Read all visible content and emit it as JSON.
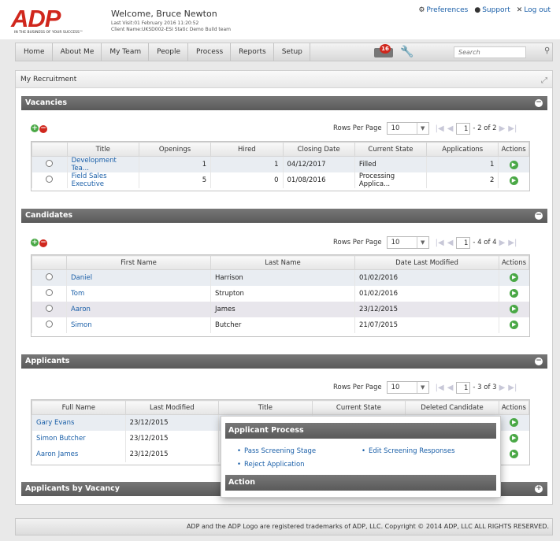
{
  "header": {
    "logo_text": "ADP",
    "logo_tagline": "IN THE BUSINESS OF YOUR SUCCESS™",
    "welcome": "Welcome, Bruce Newton",
    "last_visit": "Last Visit:01 February 2016 11:20:52",
    "client_name": "Client Name:UKSD002-ESI Static Demo Build team",
    "links": {
      "preferences": "Preferences",
      "support": "Support",
      "logout": "Log out"
    }
  },
  "nav": {
    "items": [
      "Home",
      "About Me",
      "My Team",
      "People",
      "Process",
      "Reports",
      "Setup"
    ],
    "mail_count": "16",
    "search_placeholder": "Search"
  },
  "page": {
    "title": "My Recruitment"
  },
  "vacancies": {
    "title": "Vacancies",
    "rows_per_page_label": "Rows Per Page",
    "rows_per_page": "10",
    "page_input": "1",
    "range": "- 2  of  2",
    "columns": [
      "Title",
      "Openings",
      "Hired",
      "Closing Date",
      "Current State",
      "Applications",
      "Actions"
    ],
    "rows": [
      [
        "Development Tea...",
        "1",
        "1",
        "04/12/2017",
        "Filled",
        "1"
      ],
      [
        "Field Sales Executive",
        "5",
        "0",
        "01/08/2016",
        "Processing Applica...",
        "2"
      ]
    ]
  },
  "candidates": {
    "title": "Candidates",
    "rows_per_page_label": "Rows Per Page",
    "rows_per_page": "10",
    "page_input": "1",
    "range": "- 4  of  4",
    "columns": [
      "First Name",
      "Last Name",
      "Date Last Modified",
      "Actions"
    ],
    "rows": [
      [
        "Daniel",
        "Harrison",
        "01/02/2016"
      ],
      [
        "Tom",
        "Strupton",
        "01/02/2016"
      ],
      [
        "Aaron",
        "James",
        "23/12/2015"
      ],
      [
        "Simon",
        "Butcher",
        "21/07/2015"
      ]
    ]
  },
  "applicants": {
    "title": "Applicants",
    "rows_per_page_label": "Rows Per Page",
    "rows_per_page": "10",
    "page_input": "1",
    "range": "- 3  of  3",
    "columns": [
      "Full Name",
      "Last Modified",
      "Title",
      "Current State",
      "Deleted Candidate",
      "Actions"
    ],
    "rows": [
      [
        "Gary Evans",
        "23/12/2015"
      ],
      [
        "Simon Butcher",
        "23/12/2015"
      ],
      [
        "Aaron James",
        "23/12/2015"
      ]
    ]
  },
  "applicants_by_vacancy": {
    "title": "Applicants by Vacancy"
  },
  "popup": {
    "title": "Applicant Process",
    "items": [
      "Pass Screening Stage",
      "Edit Screening Responses",
      "Reject Application"
    ],
    "action_title": "Action"
  },
  "footer": {
    "text": "ADP and the ADP Logo are registered trademarks of ADP, LLC. Copyright © 2014 ADP, LLC ALL RIGHTS RESERVED."
  }
}
